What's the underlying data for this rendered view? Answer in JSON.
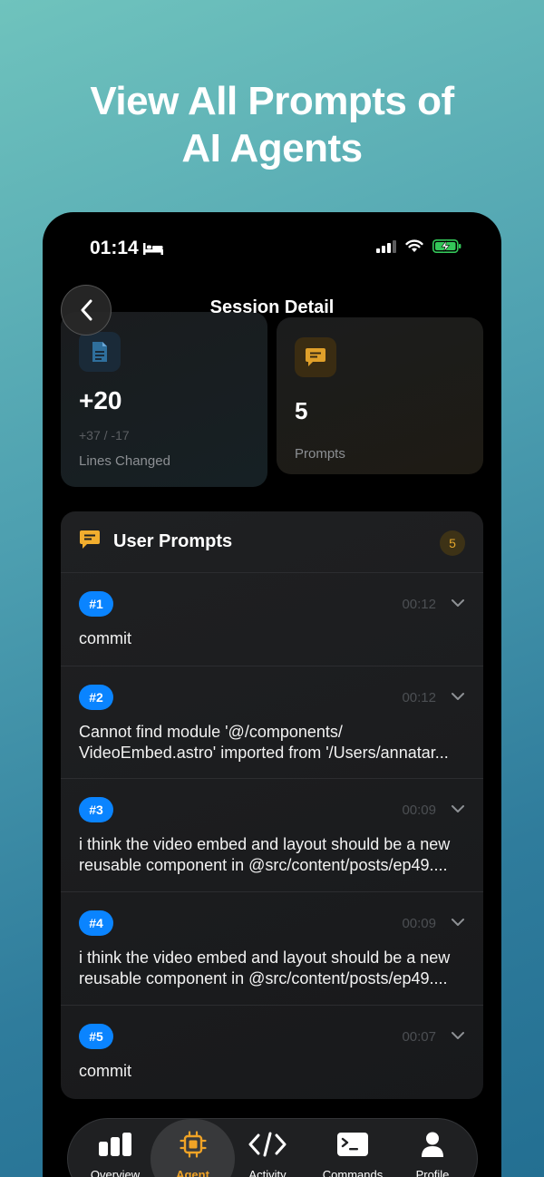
{
  "headline": {
    "line1": "View All Prompts of",
    "line2": "AI Agents"
  },
  "status_bar": {
    "time": "01:14"
  },
  "nav": {
    "title": "Session Detail"
  },
  "stats": {
    "lines": {
      "value": "+20",
      "detail": "+37 / -17",
      "label": "Lines Changed"
    },
    "prompts": {
      "value": "5",
      "label": "Prompts"
    }
  },
  "prompts_panel": {
    "title": "User Prompts",
    "count": "5",
    "items": [
      {
        "number": "#1",
        "time": "00:12",
        "line1": "commit",
        "line2": ""
      },
      {
        "number": "#2",
        "time": "00:12",
        "line1": "Cannot find module '@/components/",
        "line2": "VideoEmbed.astro' imported from '/Users/annatar..."
      },
      {
        "number": "#3",
        "time": "00:09",
        "line1": "i think the video embed and layout should be a new",
        "line2": "reusable component in @src/content/posts/ep49...."
      },
      {
        "number": "#4",
        "time": "00:09",
        "line1": "i think the video embed and layout should be a new",
        "line2": "reusable component in @src/content/posts/ep49...."
      },
      {
        "number": "#5",
        "time": "00:07",
        "line1": "commit",
        "line2": ""
      }
    ]
  },
  "tab_bar": {
    "tabs": [
      {
        "label": "Overview",
        "icon": "bar-chart-icon"
      },
      {
        "label": "Agent",
        "icon": "chip-icon"
      },
      {
        "label": "Activity",
        "icon": "code-icon"
      },
      {
        "label": "Commands",
        "icon": "terminal-icon"
      },
      {
        "label": "Profile",
        "icon": "person-icon"
      }
    ],
    "active": "Agent"
  },
  "colors": {
    "accent_blue": "#0a84ff",
    "accent_orange": "#f0a326",
    "battery_green": "#34c759"
  }
}
